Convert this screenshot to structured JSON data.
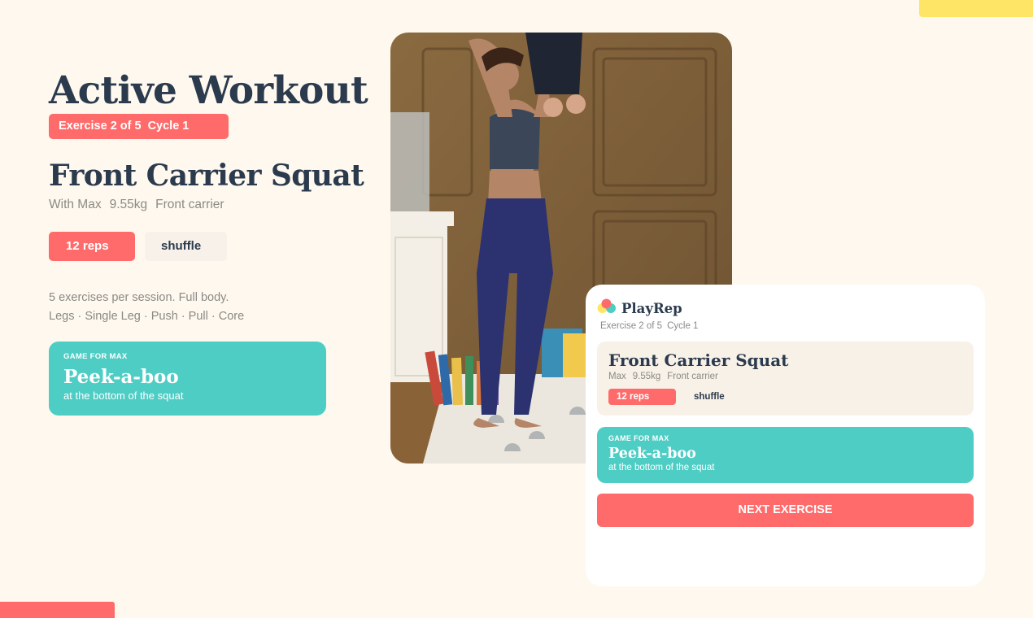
{
  "header": {
    "title": "Active Workout"
  },
  "progress": {
    "exercise": "Exercise 2 of 5",
    "cycle": "Cycle 1"
  },
  "exercise": {
    "title": "Front Carrier Squat",
    "with": "With Max",
    "weight": "9.55kg",
    "position": "Front carrier",
    "reps_label": "12 reps",
    "shuffle_label": "shuffle"
  },
  "session": {
    "line1": "5 exercises per session.  Full body.",
    "line2": "Legs · Single Leg · Push · Pull · Core"
  },
  "game": {
    "kicker": "GAME FOR MAX",
    "name": "Peek-a-boo",
    "description": "at the bottom of the squat"
  },
  "phone": {
    "brand": "PlayRep",
    "progress_exercise": "Exercise 2 of 5",
    "progress_cycle": "Cycle 1",
    "exercise_title": "Front Carrier Squat",
    "meta_name": "Max",
    "meta_weight": "9.55kg",
    "meta_position": "Front carrier",
    "reps_label": "12 reps",
    "shuffle_label": "shuffle",
    "game_kicker": "GAME FOR MAX",
    "game_name": "Peek-a-boo",
    "game_description": "at the bottom of the squat",
    "next_label": "NEXT EXERCISE"
  },
  "colors": {
    "background": "#fff8ee",
    "coral": "#ff6b6b",
    "teal": "#4ecdc4",
    "navy": "#2b3a4d",
    "yellow": "#ffe566"
  },
  "icons": {
    "brand_logo": "playrep-bubbles-icon"
  }
}
